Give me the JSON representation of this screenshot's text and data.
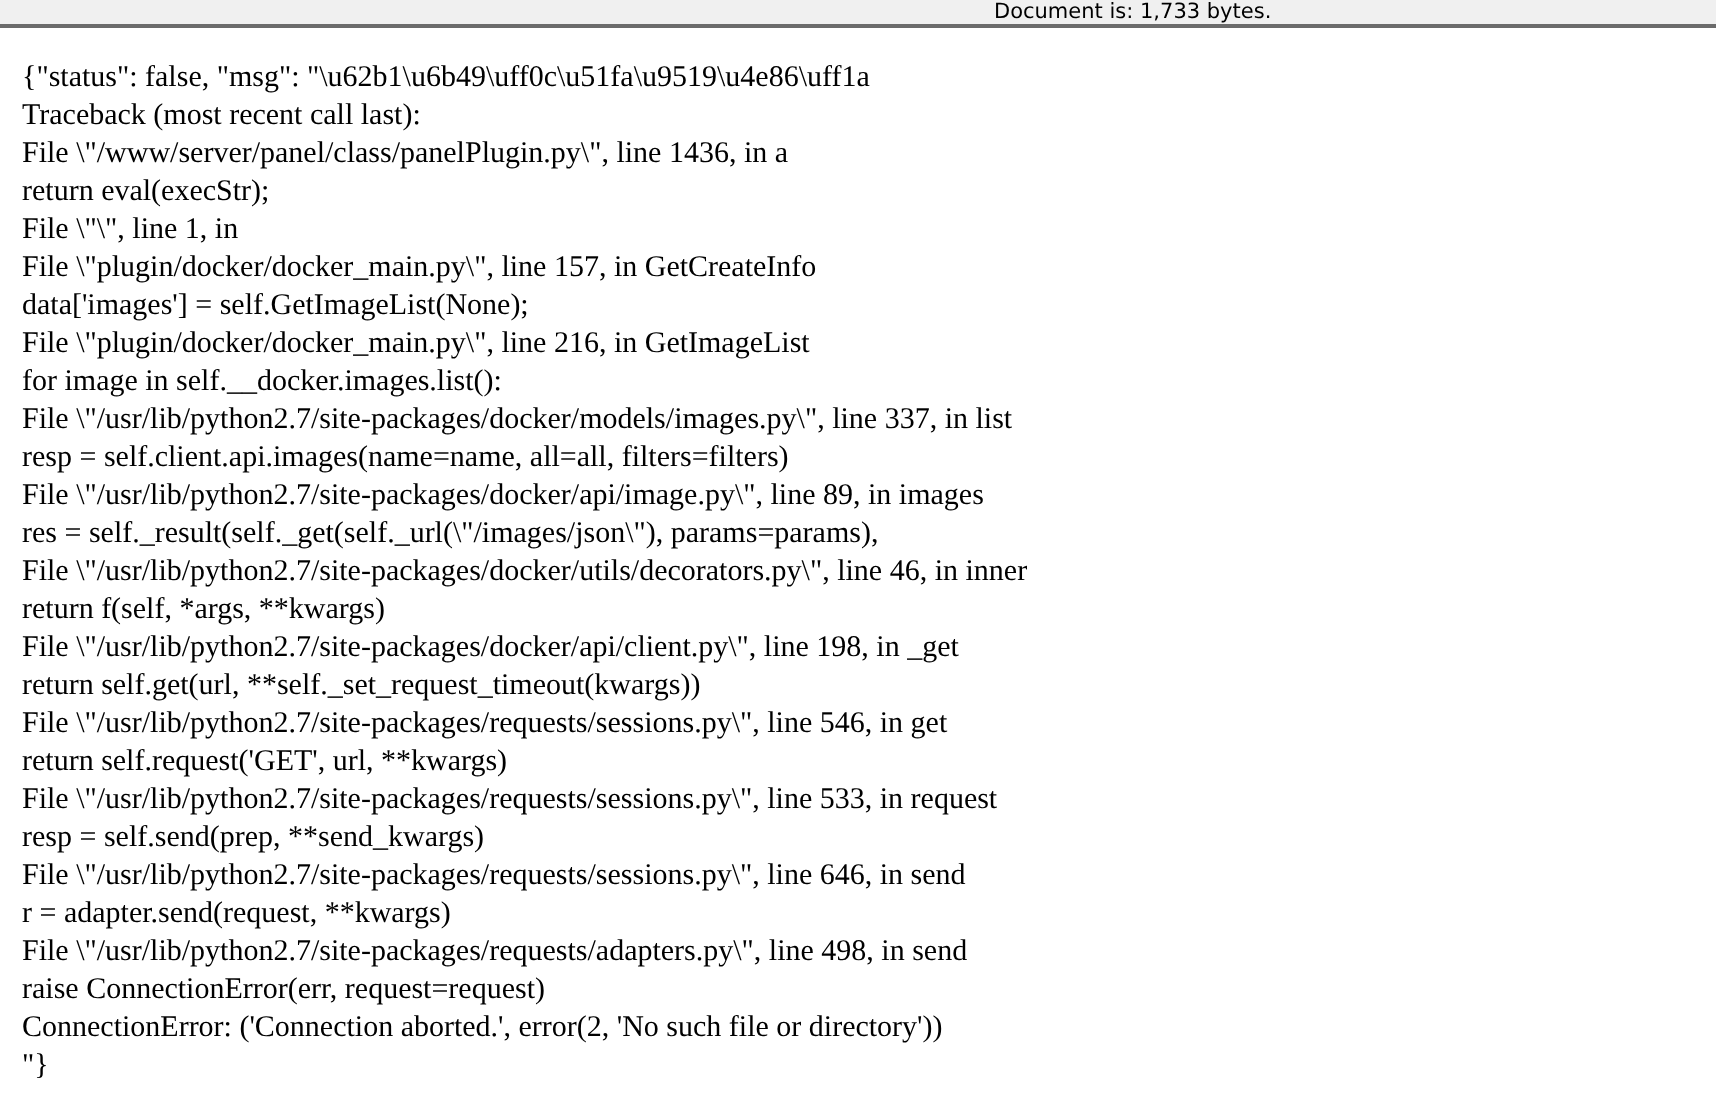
{
  "status_bar": {
    "text": "Document is: 1,733 bytes."
  },
  "document": {
    "lines": [
      "{\"status\": false, \"msg\": \"\\u62b1\\u6b49\\uff0c\\u51fa\\u9519\\u4e86\\uff1a",
      "Traceback (most recent call last):",
      "File \\\"/www/server/panel/class/panelPlugin.py\\\", line 1436, in a",
      "return eval(execStr);",
      "File \\\"\\\", line 1, in",
      "File \\\"plugin/docker/docker_main.py\\\", line 157, in GetCreateInfo",
      "data['images'] = self.GetImageList(None);",
      "File \\\"plugin/docker/docker_main.py\\\", line 216, in GetImageList",
      "for image in self.__docker.images.list():",
      "File \\\"/usr/lib/python2.7/site-packages/docker/models/images.py\\\", line 337, in list",
      "resp = self.client.api.images(name=name, all=all, filters=filters)",
      "File \\\"/usr/lib/python2.7/site-packages/docker/api/image.py\\\", line 89, in images",
      "res = self._result(self._get(self._url(\\\"/images/json\\\"), params=params),",
      "File \\\"/usr/lib/python2.7/site-packages/docker/utils/decorators.py\\\", line 46, in inner",
      "return f(self, *args, **kwargs)",
      "File \\\"/usr/lib/python2.7/site-packages/docker/api/client.py\\\", line 198, in _get",
      "return self.get(url, **self._set_request_timeout(kwargs))",
      "File \\\"/usr/lib/python2.7/site-packages/requests/sessions.py\\\", line 546, in get",
      "return self.request('GET', url, **kwargs)",
      "File \\\"/usr/lib/python2.7/site-packages/requests/sessions.py\\\", line 533, in request",
      "resp = self.send(prep, **send_kwargs)",
      "File \\\"/usr/lib/python2.7/site-packages/requests/sessions.py\\\", line 646, in send",
      "r = adapter.send(request, **kwargs)",
      "File \\\"/usr/lib/python2.7/site-packages/requests/adapters.py\\\", line 498, in send",
      "raise ConnectionError(err, request=request)",
      "ConnectionError: ('Connection aborted.', error(2, 'No such file or directory'))",
      "\"}"
    ]
  }
}
